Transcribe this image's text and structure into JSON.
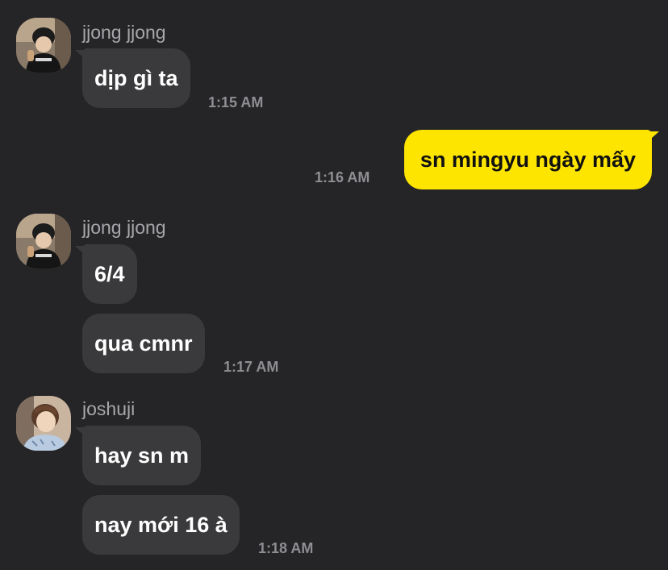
{
  "messages": {
    "group1": {
      "sender": "jjong jjong",
      "avatar_icon": "profile-photo-person-black-beanie",
      "bubbles": [
        "dịp gì ta"
      ],
      "time": "1:15 AM"
    },
    "outgoing1": {
      "text": "sn mingyu ngày mấy",
      "time": "1:16 AM",
      "bubble_color": "#fee500"
    },
    "group2": {
      "sender": "jjong jjong",
      "avatar_icon": "profile-photo-person-black-beanie",
      "bubbles": [
        "6/4",
        "qua cmnr"
      ],
      "time": "1:17 AM"
    },
    "group3": {
      "sender": "joshuji",
      "avatar_icon": "profile-photo-person-light-hair",
      "bubbles": [
        "hay sn m",
        "nay mới 16 à"
      ],
      "time": "1:18 AM"
    }
  },
  "colors": {
    "background": "#252527",
    "incoming_bubble": "#3a3a3c",
    "outgoing_bubble": "#fee500",
    "sender_name": "#a7a7ab",
    "timestamp": "#8e8e93"
  }
}
